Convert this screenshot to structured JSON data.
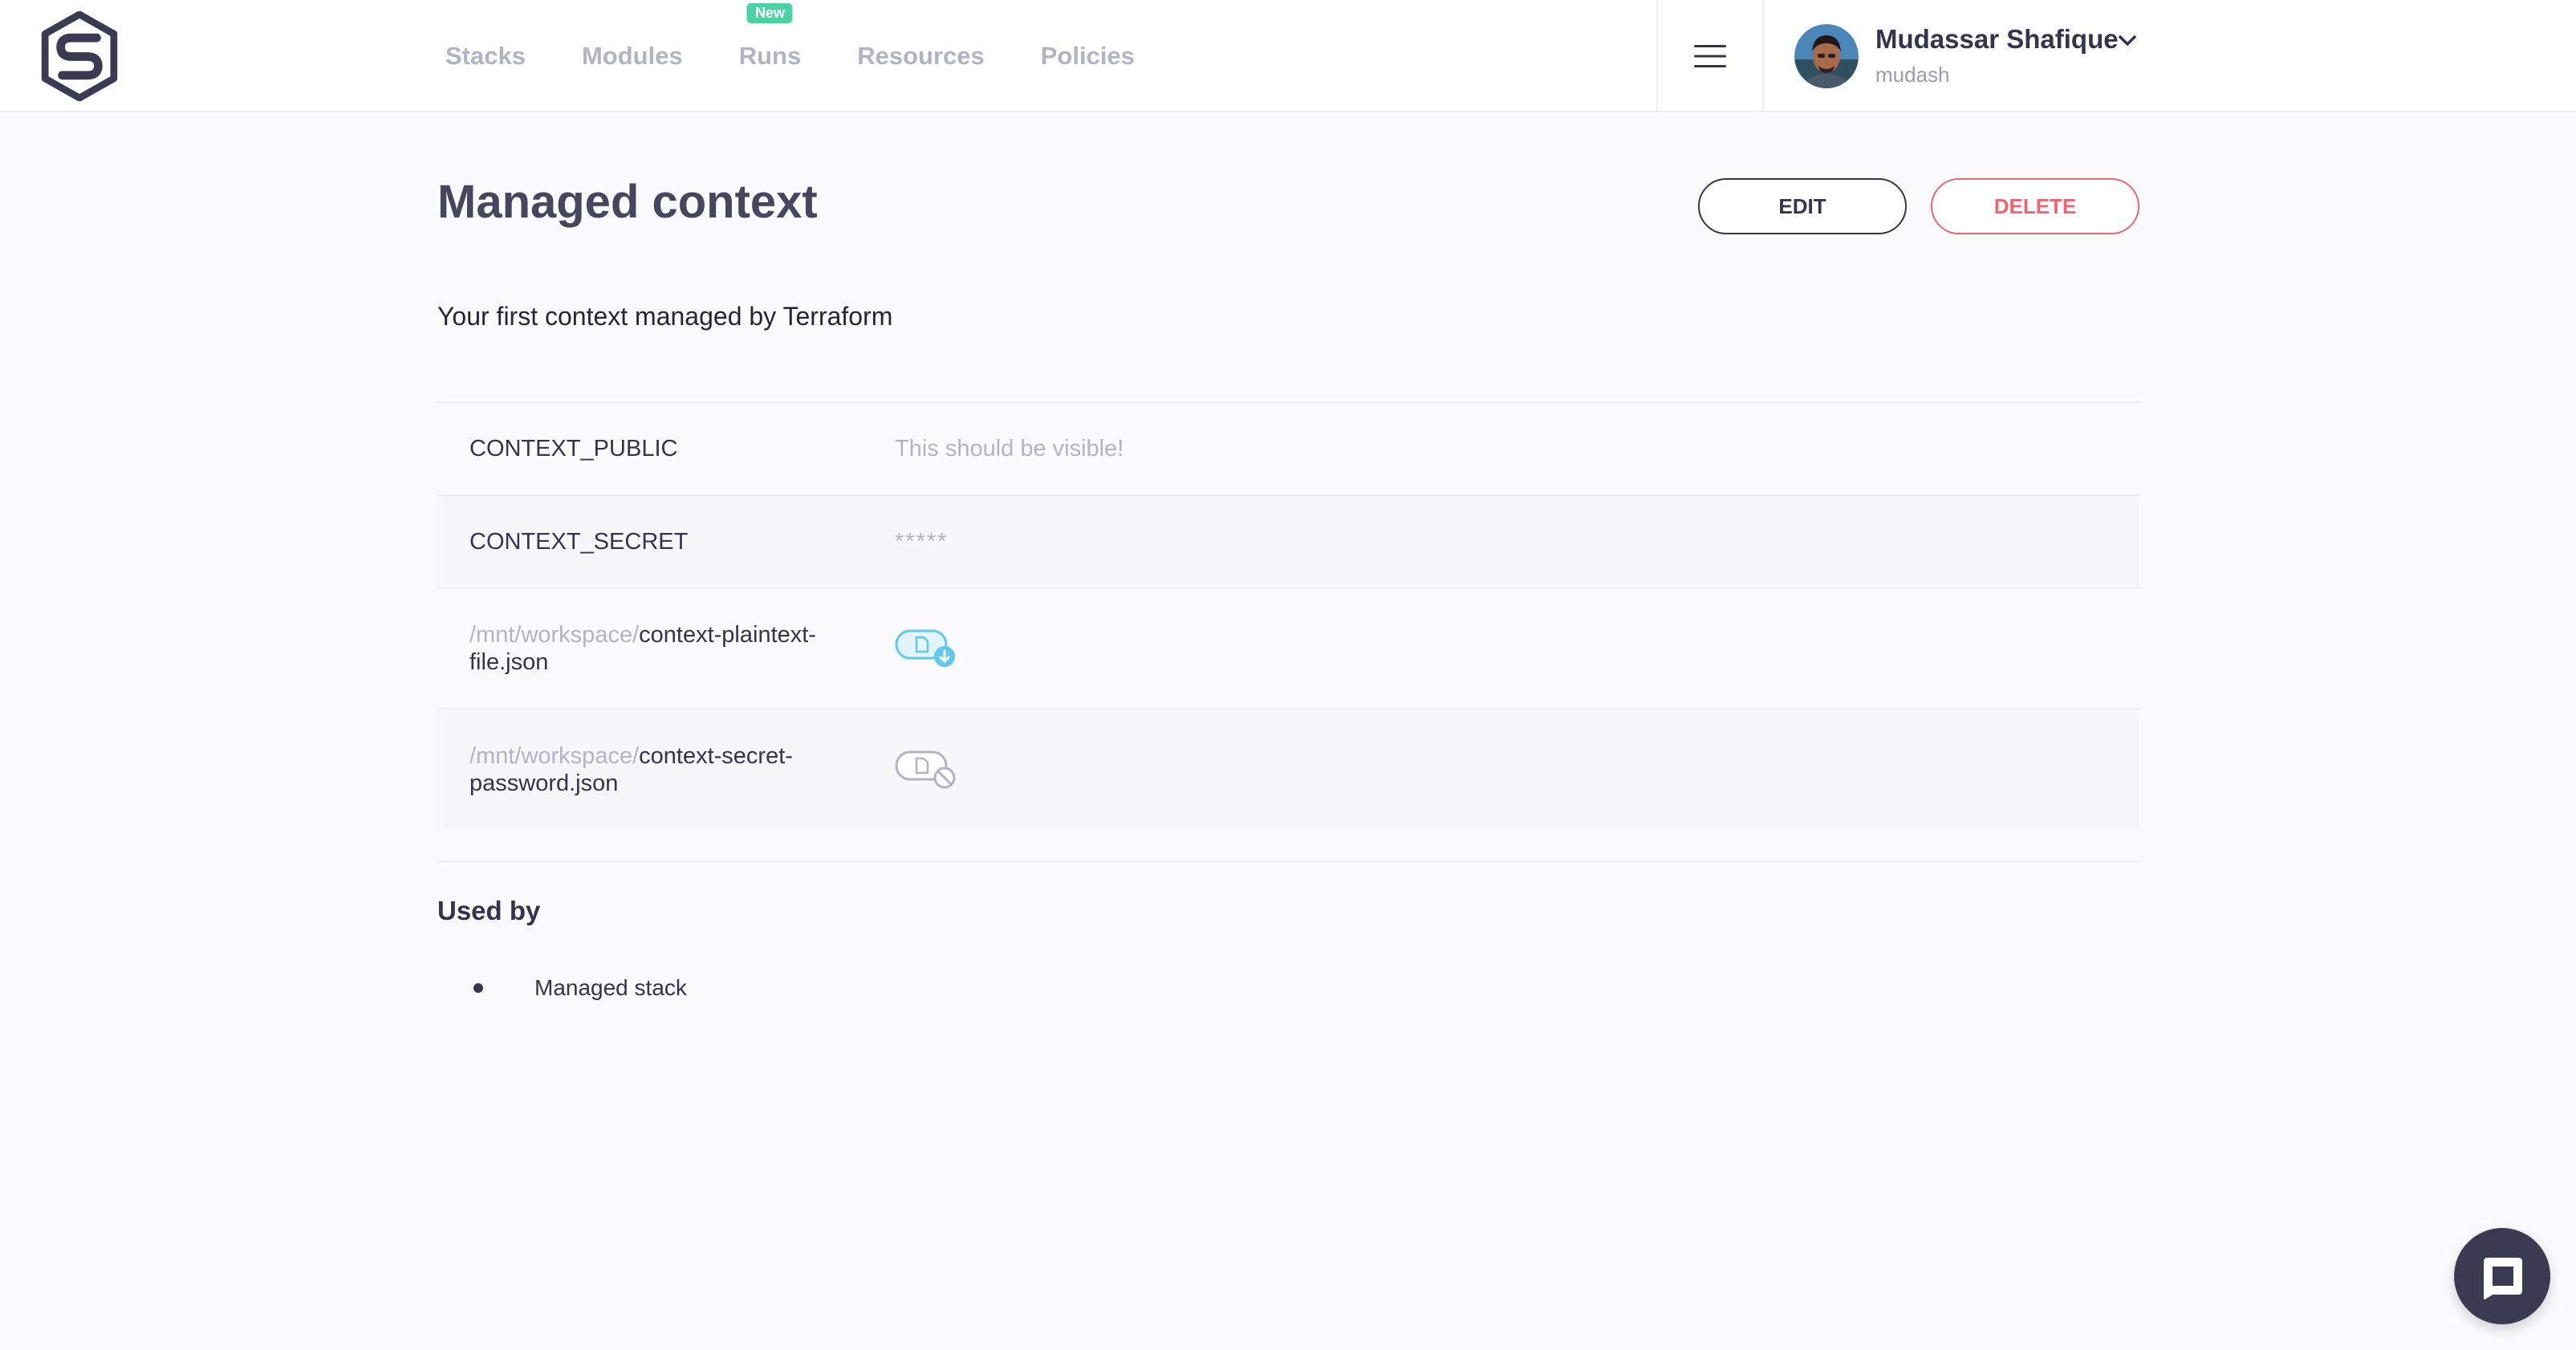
{
  "header": {
    "logo_icon": "spacelift-logo-icon",
    "nav": [
      {
        "label": "Stacks"
      },
      {
        "label": "Modules"
      },
      {
        "label": "Runs",
        "badge": "New"
      },
      {
        "label": "Resources"
      },
      {
        "label": "Policies"
      }
    ],
    "menu_icon": "hamburger-menu-icon",
    "user": {
      "name": "Mudassar Shafique",
      "handle": "mudash",
      "avatar_icon": "user-avatar"
    }
  },
  "context": {
    "title": "Managed context",
    "edit_label": "EDIT",
    "delete_label": "DELETE",
    "description": "Your first context managed by Terraform",
    "variables": [
      {
        "name": "CONTEXT_PUBLIC",
        "value": "This should be visible!"
      },
      {
        "name": "CONTEXT_SECRET",
        "value": "*****"
      }
    ],
    "files": [
      {
        "prefix": "/mnt/workspace/",
        "name_line1": "context-plaintext-",
        "name_line2": "file.json",
        "icon": "file-download-icon"
      },
      {
        "prefix": "/mnt/workspace/",
        "name_line1": "context-secret-",
        "name_line2": "password.json",
        "icon": "file-secret-icon"
      }
    ]
  },
  "used_by": {
    "title": "Used by",
    "items": [
      {
        "label": "Managed stack"
      }
    ]
  },
  "colors": {
    "accent": "#35334d",
    "danger": "#f06470",
    "new_badge": "#4cd2a4",
    "file_download": "#60c7ee"
  }
}
